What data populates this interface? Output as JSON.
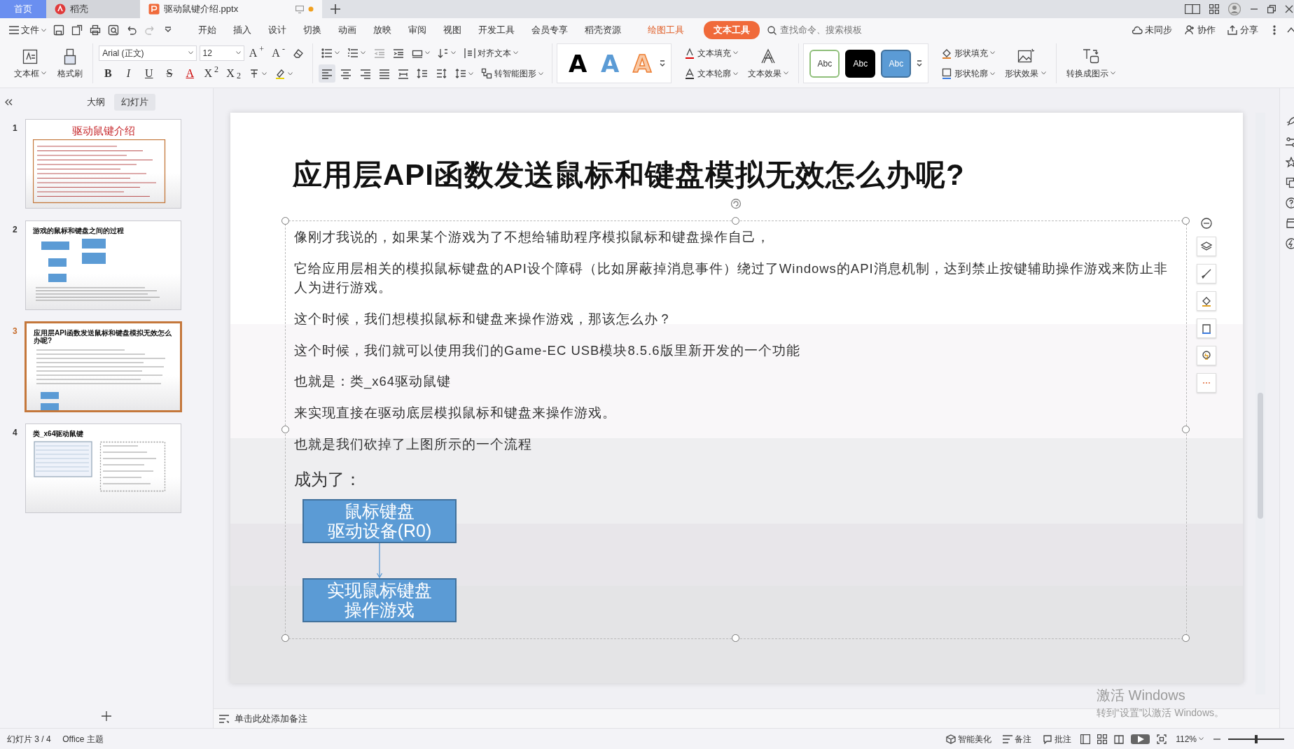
{
  "window_tabs": [
    {
      "label": "首页",
      "kind": "home",
      "selected": false
    },
    {
      "label": "稻壳",
      "kind": "store",
      "selected": false
    },
    {
      "label": "驱动鼠键介绍.pptx",
      "kind": "document",
      "selected": true,
      "unsaved": true
    }
  ],
  "menu": {
    "file": "文件",
    "tabs": [
      {
        "label": "开始",
        "kind": "tab",
        "selected": false
      },
      {
        "label": "插入",
        "kind": "tab",
        "selected": false
      },
      {
        "label": "设计",
        "kind": "tab",
        "selected": false
      },
      {
        "label": "切换",
        "kind": "tab",
        "selected": false
      },
      {
        "label": "动画",
        "kind": "tab",
        "selected": false
      },
      {
        "label": "放映",
        "kind": "tab",
        "selected": false
      },
      {
        "label": "审阅",
        "kind": "tab",
        "selected": false
      },
      {
        "label": "视图",
        "kind": "tab",
        "selected": false
      },
      {
        "label": "开发工具",
        "kind": "tab",
        "selected": false
      },
      {
        "label": "会员专享",
        "kind": "tab",
        "selected": false
      },
      {
        "label": "稻壳资源",
        "kind": "tab",
        "selected": false
      },
      {
        "label": "绘图工具",
        "kind": "context",
        "selected": false
      },
      {
        "label": "文本工具",
        "kind": "context",
        "selected": true
      }
    ],
    "search": {
      "placeholder": "查找命令、搜索模板"
    },
    "actions": [
      "未同步",
      "协作",
      "分享"
    ]
  },
  "ribbon": {
    "large_left": [
      {
        "label": "文本框",
        "dropdown": true
      },
      {
        "label": "格式刷",
        "dropdown": false
      }
    ],
    "font": {
      "name": "Arial (正文)",
      "size": "12"
    },
    "size_buttons": [
      "A$^{+}$",
      "A$^{-}$"
    ],
    "format_buttons": [
      {
        "label": "B",
        "kind": "bold"
      },
      {
        "label": "I",
        "kind": "italic"
      },
      {
        "label": "U",
        "kind": "underline"
      },
      {
        "label": "S",
        "kind": "strike"
      },
      {
        "label": "A",
        "kind": "color"
      },
      {
        "label": "X$^{2}$",
        "kind": "plain"
      },
      {
        "label": "X$_{2}$",
        "kind": "plain"
      }
    ],
    "align_buttons": [
      {
        "selected": true
      },
      {
        "selected": false
      },
      {
        "selected": false
      },
      {
        "selected": false
      },
      {
        "selected": false
      }
    ],
    "align_text": "对齐文本",
    "smart_art": "转智能图形",
    "text_styles": [
      {
        "label": "A",
        "kind": "black"
      },
      {
        "label": "A",
        "kind": "blue"
      },
      {
        "label": "A",
        "kind": "orange"
      }
    ],
    "text_fill": "文本填充",
    "text_outline": "文本轮廓",
    "text_effect": "文本效果",
    "shape_styles": [
      {
        "label": "Abc",
        "kind": "outline"
      },
      {
        "label": "Abc",
        "kind": "dark"
      },
      {
        "label": "Abc",
        "kind": "blue"
      }
    ],
    "shape_fill": "形状填充",
    "shape_outline": "形状轮廓",
    "shape_effect": "形状效果",
    "convert": "转换成图示"
  },
  "panel": {
    "tabs": [
      {
        "label": "大纲",
        "selected": false
      },
      {
        "label": "幻灯片",
        "selected": true
      }
    ],
    "slides": [
      {
        "number": "1",
        "title": "驱动鼠键介绍",
        "kind": "cover",
        "selected": false
      },
      {
        "number": "2",
        "title": "游戏的鼠标和键盘之间的过程",
        "kind": "diagram",
        "selected": false
      },
      {
        "number": "3",
        "title": "应用层API函数发送鼠标和键盘模拟无效怎么办呢?",
        "kind": "text",
        "selected": true
      },
      {
        "number": "4",
        "title": "类_x64驱动鼠键",
        "kind": "table",
        "selected": false
      }
    ]
  },
  "slide": {
    "title": "应用层API函数发送鼠标和键盘模拟无效怎么办呢?",
    "paragraphs": [
      "像刚才我说的，如果某个游戏为了不想给辅助程序模拟鼠标和键盘操作自己，",
      "它给应用层相关的模拟鼠标键盘的API设个障碍（比如屏蔽掉消息事件）绕过了Windows的API消息机制，达到禁止按键辅助操作游戏来防止非人为进行游戏。",
      "这个时候，我们想模拟鼠标和键盘来操作游戏，那该怎么办？",
      "这个时候，我们就可以使用我们的Game-EC USB模块8.5.6版里新开发的一个功能",
      "也就是：类_x64驱动鼠键",
      "来实现直接在驱动底层模拟鼠标和键盘来操作游戏。",
      "也就是我们砍掉了上图所示的一个流程"
    ],
    "subheading": "成为了：",
    "flow": [
      {
        "lines": [
          "鼠标键盘",
          "驱动设备(R0)"
        ]
      },
      {
        "lines": [
          "实现鼠标键盘",
          "操作游戏"
        ]
      }
    ]
  },
  "notes": {
    "placeholder": "单击此处添加备注"
  },
  "status_bar": {
    "slide_counter": "幻灯片 3 / 4",
    "theme": "Office 主题",
    "beautify": "智能美化",
    "notes": "备注",
    "comments": "批注",
    "zoom": "112%",
    "zoom_slider": {
      "level": 0.5
    }
  },
  "activation": {
    "title": "激活 Windows",
    "message": "转到“设置”以激活 Windows。"
  }
}
